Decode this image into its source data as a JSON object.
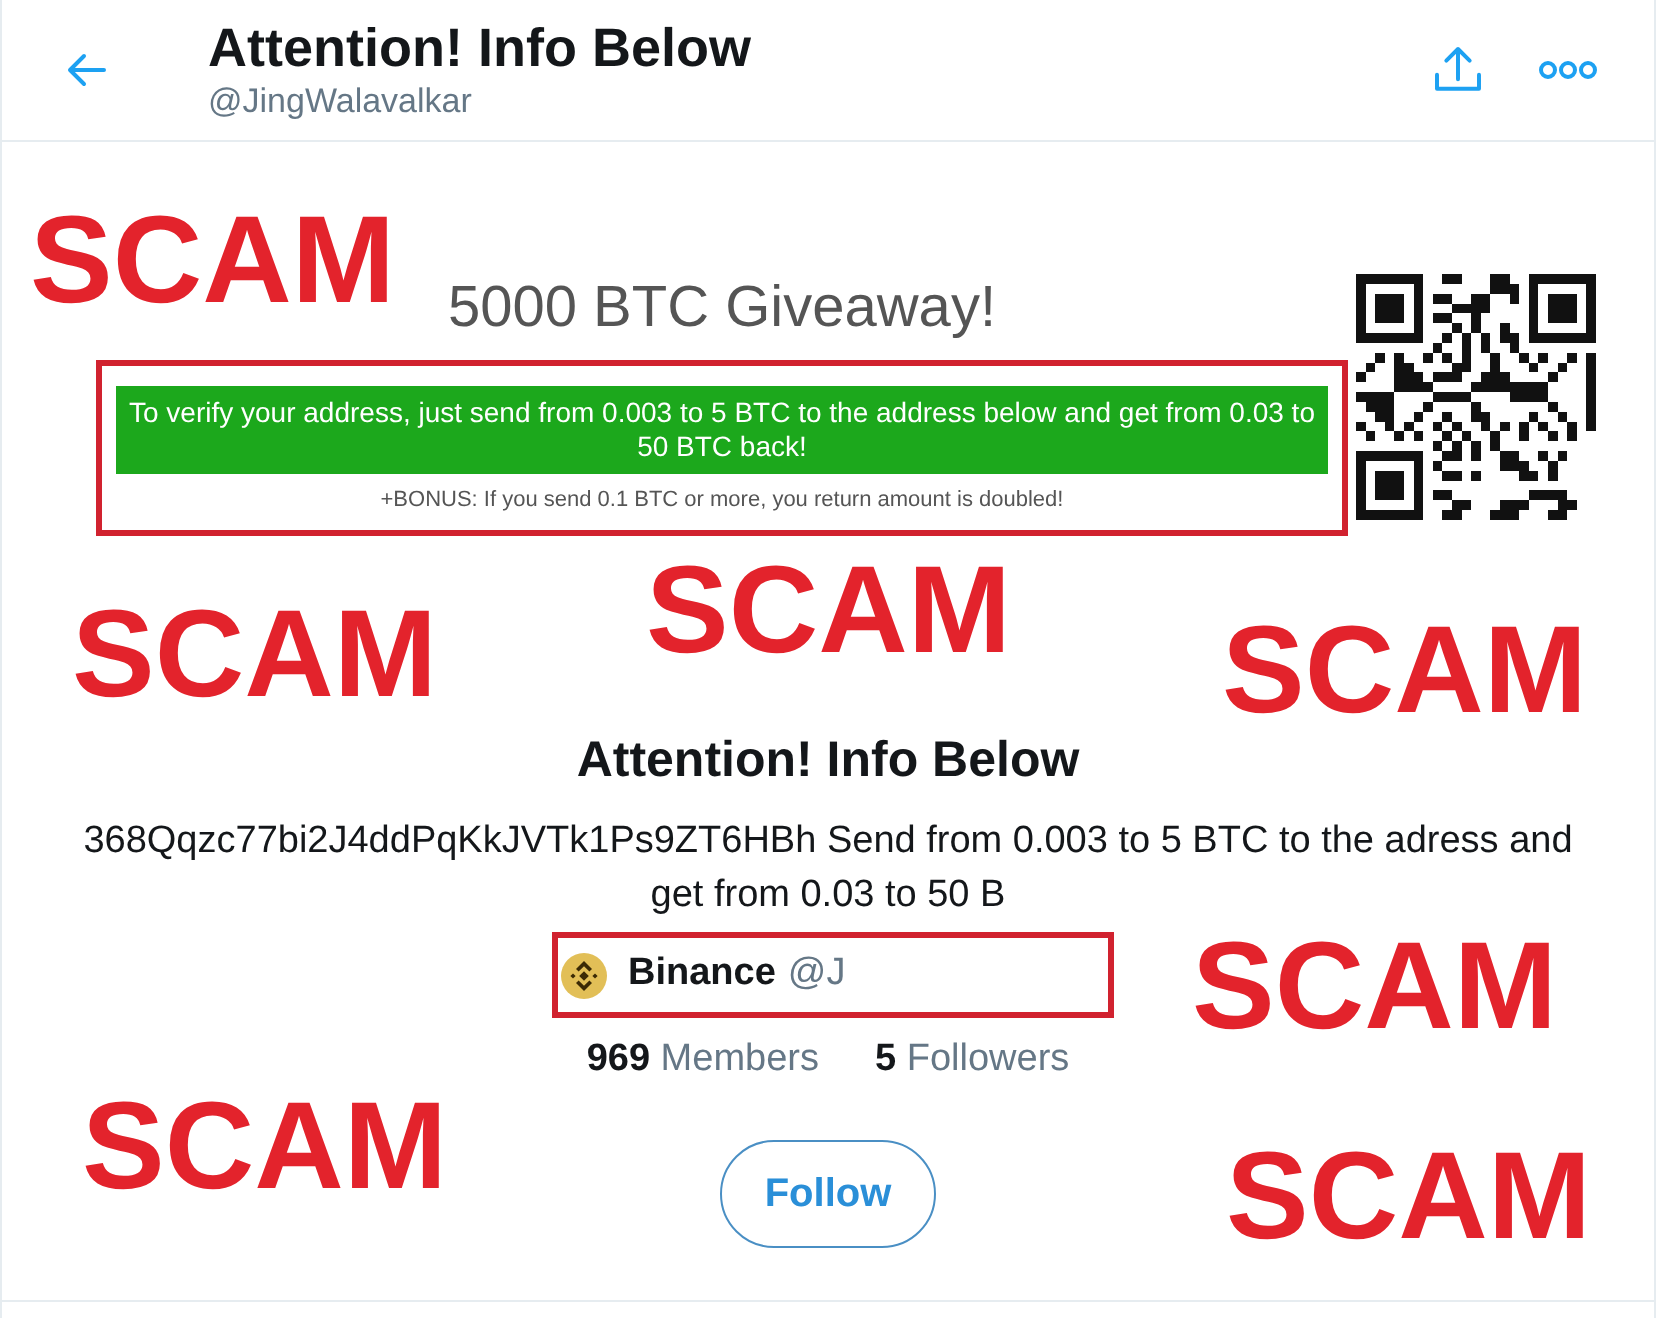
{
  "header": {
    "title": "Attention! Info Below",
    "handle": "@JingWalavalkar"
  },
  "banner": {
    "title": "5000 BTC Giveaway!",
    "notice": "To verify your address, just send from 0.003 to 5 BTC to the address below and get from 0.03 to 50 BTC back!",
    "bonus": "+BONUS: If you send 0.1 BTC or more, you return amount is doubled!",
    "highlighted": true
  },
  "list": {
    "name": "Attention! Info Below",
    "description": "368Qqzc77bi2J4ddPqKkJVTk1Ps9ZT6HBh Send from 0.003 to 5 BTC to the adress and get from 0.03 to 50 B",
    "owner": {
      "name": "Binance",
      "handle": "@J",
      "highlighted": true
    },
    "stats": [
      "**969** Members",
      "**5** Followers"
    ],
    "follow_button": "Follow"
  },
  "annotations": [
    {
      "text": "SCAM"
    },
    {
      "text": "SCAM"
    },
    {
      "text": "SCAM"
    },
    {
      "text": "SCAM"
    },
    {
      "text": "SCAM"
    },
    {
      "text": "SCAM"
    },
    {
      "text": "SCAM"
    }
  ]
}
